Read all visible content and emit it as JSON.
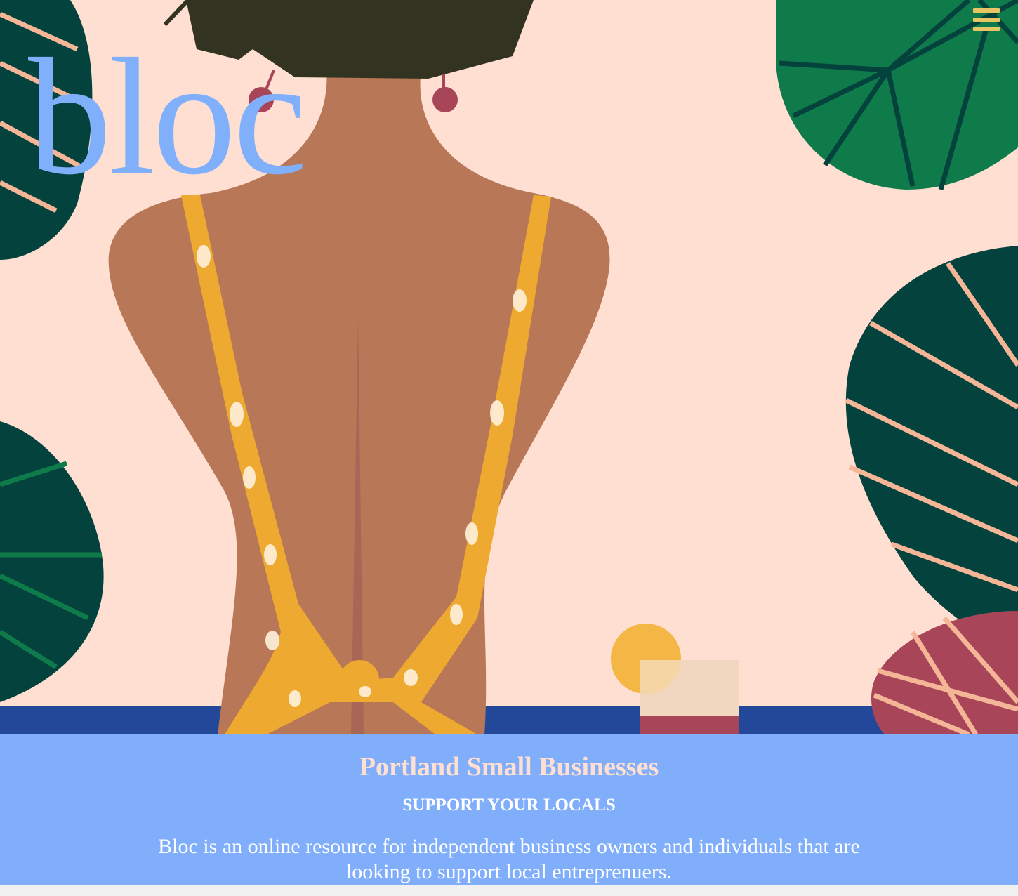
{
  "brand": {
    "logo_text": "bloc"
  },
  "nav": {
    "menu_icon": "hamburger-menu-icon"
  },
  "hero": {
    "illustration": "woman-back-with-tropical-leaves-illustration"
  },
  "intro": {
    "title": "Portland Small Businesses",
    "subtitle": "SUPPORT YOUR LOCALS",
    "description": "Bloc is an online resource for independent business owners and individuals that are looking to support local entreprenuers."
  },
  "colors": {
    "accent_blue": "#80b0fb",
    "peach": "#ffdfd2",
    "menu_yellow": "#e8c564",
    "leaf_green": "#0f7a4a",
    "leaf_dark": "#04433d",
    "skin": "#b87757",
    "swimsuit": "#eeaa30",
    "pool_blue": "#23489a"
  }
}
